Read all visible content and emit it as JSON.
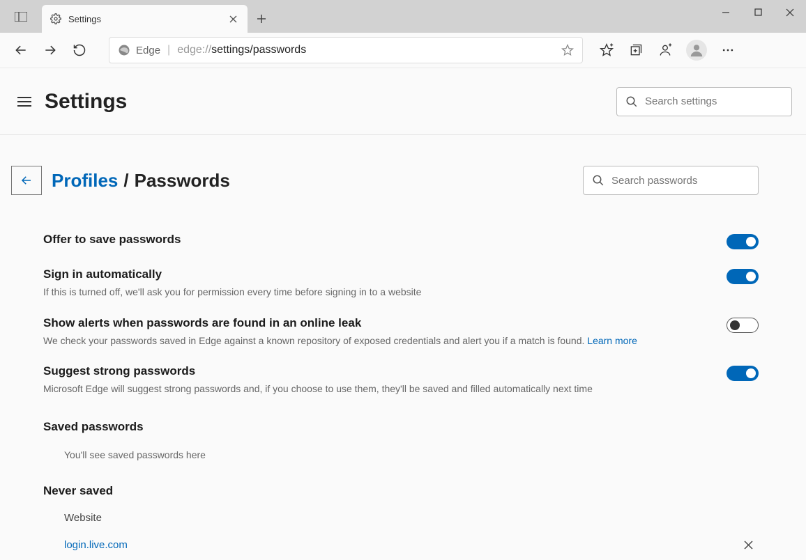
{
  "window": {
    "tab_title": "Settings",
    "new_tab_tooltip": "New tab"
  },
  "address": {
    "identity": "Edge",
    "url_prefix": "edge://",
    "url_path_strong": "settings/passwords"
  },
  "header": {
    "title": "Settings",
    "search_placeholder": "Search settings"
  },
  "breadcrumb": {
    "link": "Profiles",
    "separator": "/",
    "current": "Passwords",
    "search_placeholder": "Search passwords"
  },
  "settings": {
    "offer": {
      "title": "Offer to save passwords",
      "on": true
    },
    "signin": {
      "title": "Sign in automatically",
      "desc": "If this is turned off, we'll ask you for permission every time before signing in to a website",
      "on": true
    },
    "leak": {
      "title": "Show alerts when passwords are found in an online leak",
      "desc": "We check your passwords saved in Edge against a known repository of exposed credentials and alert you if a match is found. ",
      "learn_more": "Learn more",
      "on": false
    },
    "suggest": {
      "title": "Suggest strong passwords",
      "desc": "Microsoft Edge will suggest strong passwords and, if you choose to use them, they'll be saved and filled automatically next time",
      "on": true
    }
  },
  "saved": {
    "heading": "Saved passwords",
    "empty": "You'll see saved passwords here"
  },
  "never": {
    "heading": "Never saved",
    "col_website": "Website",
    "items": [
      {
        "site": "login.live.com"
      }
    ]
  }
}
